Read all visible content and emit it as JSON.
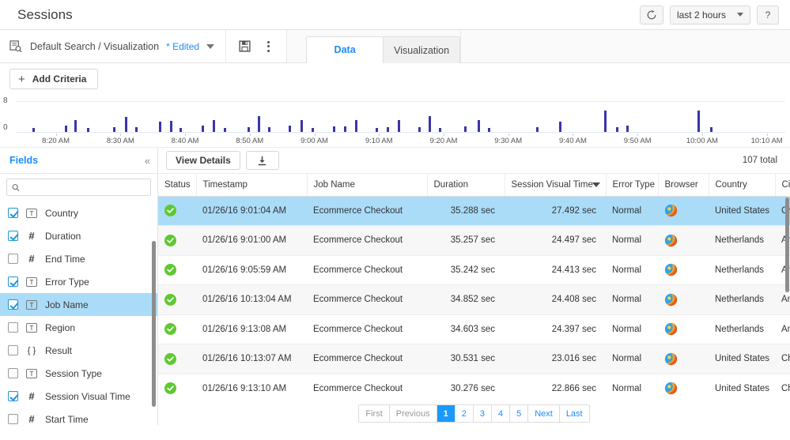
{
  "header": {
    "title": "Sessions",
    "refresh_icon": "refresh-icon",
    "time_range": "last 2 hours",
    "help_label": "?"
  },
  "searchbar": {
    "search_icon": "search-document-icon",
    "name": "Default Search / Visualization",
    "edited_label": "* Edited",
    "dropdown_icon": "chevron-down-icon",
    "save_icon": "save-icon",
    "more_icon": "more-vertical-icon",
    "tabs": [
      {
        "label": "Data",
        "active": true
      },
      {
        "label": "Visualization",
        "active": false
      }
    ]
  },
  "criteria": {
    "add_label": "Add Criteria",
    "plus_icon": "plus-icon"
  },
  "chart_data": {
    "type": "bar",
    "title": "",
    "xlabel": "",
    "ylabel": "",
    "ylim": [
      0,
      8
    ],
    "ytick_labels": [
      "8",
      "0"
    ],
    "grid": true,
    "legend": false,
    "xtick_labels": [
      "8:20 AM",
      "8:30 AM",
      "8:40 AM",
      "8:50 AM",
      "9:00 AM",
      "9:10 AM",
      "9:20 AM",
      "9:30 AM",
      "9:40 AM",
      "9:50 AM",
      "10:00 AM",
      "10:10 AM"
    ],
    "xtick_positions": [
      5.2,
      13.6,
      22.0,
      30.4,
      38.8,
      47.2,
      55.6,
      64.0,
      72.4,
      80.8,
      89.2,
      97.6
    ],
    "x": [
      2.2,
      6.4,
      7.6,
      9.2,
      12.6,
      14.2,
      15.5,
      18.6,
      20.0,
      21.3,
      24.2,
      25.6,
      27.0,
      30.1,
      31.4,
      32.8,
      35.5,
      37.0,
      38.4,
      41.2,
      42.7,
      44.1,
      46.8,
      48.2,
      49.6,
      52.3,
      53.6,
      55.0,
      58.3,
      60.0,
      61.4,
      67.6,
      70.6,
      76.5,
      78.0,
      79.3,
      88.6,
      90.2
    ],
    "values": [
      1.0,
      1.6,
      3.0,
      1.0,
      1.2,
      4.0,
      1.2,
      2.7,
      2.8,
      1.0,
      1.7,
      3.0,
      1.0,
      1.2,
      4.2,
      1.2,
      1.6,
      3.0,
      1.0,
      1.4,
      1.5,
      3.0,
      1.0,
      1.2,
      3.0,
      1.2,
      4.2,
      1.0,
      1.5,
      3.0,
      1.0,
      1.2,
      2.6,
      5.6,
      1.3,
      1.6,
      5.6,
      1.3
    ],
    "bar_color": "#3b34a8"
  },
  "sidebar": {
    "title": "Fields",
    "collapse_icon": "collapse-left-icon",
    "search_icon": "search-icon",
    "search_value": "",
    "search_placeholder": "",
    "items": [
      {
        "label": "Country",
        "type": "T",
        "checked": true,
        "selected": false
      },
      {
        "label": "Duration",
        "type": "#",
        "checked": true,
        "selected": false
      },
      {
        "label": "End Time",
        "type": "#",
        "checked": false,
        "selected": false
      },
      {
        "label": "Error Type",
        "type": "T",
        "checked": true,
        "selected": false
      },
      {
        "label": "Job Name",
        "type": "T",
        "checked": true,
        "selected": true
      },
      {
        "label": "Region",
        "type": "T",
        "checked": false,
        "selected": false
      },
      {
        "label": "Result",
        "type": "{ }",
        "checked": false,
        "selected": false
      },
      {
        "label": "Session Type",
        "type": "T",
        "checked": false,
        "selected": false
      },
      {
        "label": "Session Visual Time",
        "type": "#",
        "checked": true,
        "selected": false
      },
      {
        "label": "Start Time",
        "type": "#",
        "checked": false,
        "selected": false
      }
    ]
  },
  "toolbar": {
    "view_details_label": "View Details",
    "download_icon": "download-icon",
    "total_label": "107 total"
  },
  "table": {
    "columns": [
      {
        "key": "status",
        "label": "Status",
        "sorted": false
      },
      {
        "key": "timestamp",
        "label": "Timestamp",
        "sorted": false
      },
      {
        "key": "job_name",
        "label": "Job Name",
        "sorted": false
      },
      {
        "key": "duration",
        "label": "Duration",
        "sorted": false
      },
      {
        "key": "session_visual_time",
        "label": "Session Visual Time",
        "sorted": true
      },
      {
        "key": "error_type",
        "label": "Error Type",
        "sorted": false
      },
      {
        "key": "browser",
        "label": "Browser",
        "sorted": false
      },
      {
        "key": "country",
        "label": "Country",
        "sorted": false
      },
      {
        "key": "city",
        "label": "City",
        "sorted": false
      }
    ],
    "rows": [
      {
        "status": "success",
        "timestamp": "01/26/16 9:01:04 AM",
        "job_name": "Ecommerce Checkout",
        "duration": "35.288 sec",
        "session_visual_time": "27.492 sec",
        "error_type": "Normal",
        "browser": "firefox",
        "country": "United States",
        "city": "Charlotte",
        "selected": true
      },
      {
        "status": "success",
        "timestamp": "01/26/16 9:01:00 AM",
        "job_name": "Ecommerce Checkout",
        "duration": "35.257 sec",
        "session_visual_time": "24.497 sec",
        "error_type": "Normal",
        "browser": "firefox",
        "country": "Netherlands",
        "city": "Amsterdam",
        "selected": false
      },
      {
        "status": "success",
        "timestamp": "01/26/16 9:05:59 AM",
        "job_name": "Ecommerce Checkout",
        "duration": "35.242 sec",
        "session_visual_time": "24.413 sec",
        "error_type": "Normal",
        "browser": "firefox",
        "country": "Netherlands",
        "city": "Amsterdam",
        "selected": false
      },
      {
        "status": "success",
        "timestamp": "01/26/16 10:13:04 AM",
        "job_name": "Ecommerce Checkout",
        "duration": "34.852 sec",
        "session_visual_time": "24.408 sec",
        "error_type": "Normal",
        "browser": "firefox",
        "country": "Netherlands",
        "city": "Amsterdam",
        "selected": false
      },
      {
        "status": "success",
        "timestamp": "01/26/16 9:13:08 AM",
        "job_name": "Ecommerce Checkout",
        "duration": "34.603 sec",
        "session_visual_time": "24.397 sec",
        "error_type": "Normal",
        "browser": "firefox",
        "country": "Netherlands",
        "city": "Amsterdam",
        "selected": false
      },
      {
        "status": "success",
        "timestamp": "01/26/16 10:13:07 AM",
        "job_name": "Ecommerce Checkout",
        "duration": "30.531 sec",
        "session_visual_time": "23.016 sec",
        "error_type": "Normal",
        "browser": "firefox",
        "country": "United States",
        "city": "Charlotte",
        "selected": false
      },
      {
        "status": "success",
        "timestamp": "01/26/16 9:13:10 AM",
        "job_name": "Ecommerce Checkout",
        "duration": "30.276 sec",
        "session_visual_time": "22.866 sec",
        "error_type": "Normal",
        "browser": "firefox",
        "country": "United States",
        "city": "Charlotte",
        "selected": false
      }
    ]
  },
  "pagination": [
    {
      "label": "First",
      "state": "muted"
    },
    {
      "label": "Previous",
      "state": "muted"
    },
    {
      "label": "1",
      "state": "active"
    },
    {
      "label": "2",
      "state": "link"
    },
    {
      "label": "3",
      "state": "link"
    },
    {
      "label": "4",
      "state": "link"
    },
    {
      "label": "5",
      "state": "link"
    },
    {
      "label": "Next",
      "state": "link"
    },
    {
      "label": "Last",
      "state": "link"
    }
  ],
  "colors": {
    "accent": "#1a8cff",
    "selection": "#aadcf8",
    "status_success": "#5ec931",
    "bar": "#3b34a8"
  }
}
